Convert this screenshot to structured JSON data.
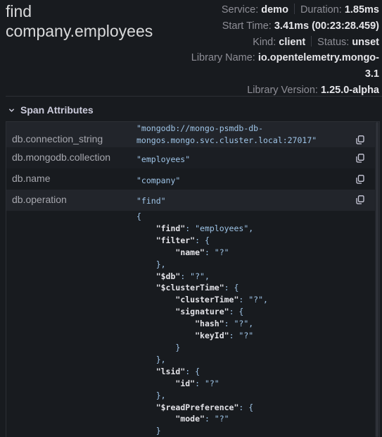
{
  "span": {
    "title_line1": "find",
    "title_line2": "company.employees"
  },
  "meta": {
    "service_label": "Service:",
    "service_value": "demo",
    "duration_label": "Duration:",
    "duration_value": "1.85ms",
    "start_label": "Start Time:",
    "start_value": "3.41ms (00:23:28.459)",
    "kind_label": "Kind:",
    "kind_value": "client",
    "status_label": "Status:",
    "status_value": "unset",
    "libname_label": "Library Name:",
    "libname_value_1": "io.opentelemetry.mongo-",
    "libname_value_2": "3.1",
    "libver_label": "Library Version:",
    "libver_value": "1.25.0-alpha"
  },
  "section": {
    "title": "Span Attributes"
  },
  "attributes": [
    {
      "key": "db.connection_string",
      "value_line1": "\"mongodb://mongo-psmdb-db-",
      "value_line2": "mongos.mongo.svc.cluster.local:27017\""
    },
    {
      "key": "db.mongodb.collection",
      "value": "\"employees\""
    },
    {
      "key": "db.name",
      "value": "\"company\""
    },
    {
      "key": "db.operation",
      "value": "\"find\""
    }
  ],
  "statement_lines": [
    {
      "i": 0,
      "k": "",
      "t": "{"
    },
    {
      "i": 1,
      "k": "\"find\"",
      "t": ": \"employees\","
    },
    {
      "i": 1,
      "k": "\"filter\"",
      "t": ": {"
    },
    {
      "i": 2,
      "k": "\"name\"",
      "t": ": \"?\""
    },
    {
      "i": 1,
      "k": "",
      "t": "},"
    },
    {
      "i": 1,
      "k": "\"$db\"",
      "t": ": \"?\","
    },
    {
      "i": 1,
      "k": "\"$clusterTime\"",
      "t": ": {"
    },
    {
      "i": 2,
      "k": "\"clusterTime\"",
      "t": ": \"?\","
    },
    {
      "i": 2,
      "k": "\"signature\"",
      "t": ": {"
    },
    {
      "i": 3,
      "k": "\"hash\"",
      "t": ": \"?\","
    },
    {
      "i": 3,
      "k": "\"keyId\"",
      "t": ": \"?\""
    },
    {
      "i": 2,
      "k": "",
      "t": "}"
    },
    {
      "i": 1,
      "k": "",
      "t": "},"
    },
    {
      "i": 1,
      "k": "\"lsid\"",
      "t": ": {"
    },
    {
      "i": 2,
      "k": "\"id\"",
      "t": ": \"?\""
    },
    {
      "i": 1,
      "k": "",
      "t": "},"
    },
    {
      "i": 1,
      "k": "\"$readPreference\"",
      "t": ": {"
    },
    {
      "i": 2,
      "k": "\"mode\"",
      "t": ": \"?\""
    },
    {
      "i": 1,
      "k": "",
      "t": "}"
    }
  ],
  "icons": {
    "chevron": "chevron-down-icon",
    "copy": "copy-icon"
  },
  "colors": {
    "background": "#181b1f",
    "row_alt": "#22252b",
    "value": "#9fc5e8",
    "key": "#a6a7ae"
  }
}
